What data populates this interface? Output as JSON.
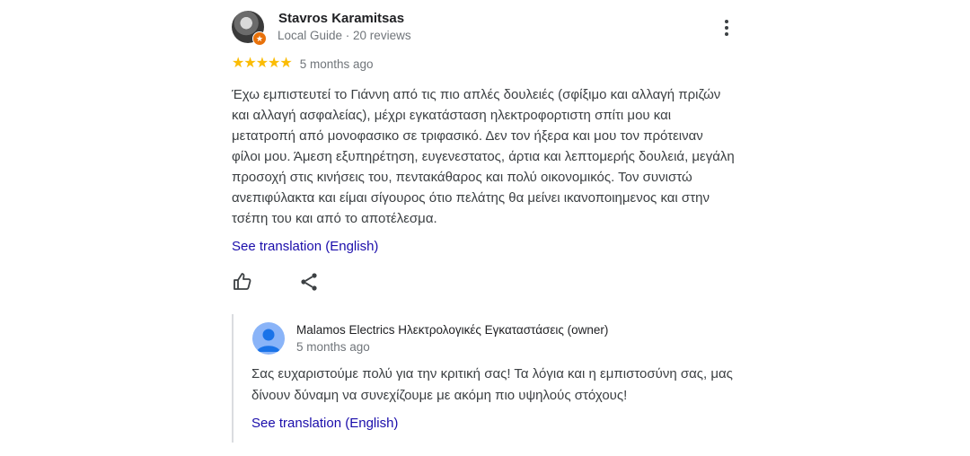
{
  "review": {
    "reviewer_name": "Stavros Karamitsas",
    "reviewer_meta": "Local Guide · 20 reviews",
    "rating": 5,
    "stars": "★★★★★",
    "time": "5 months ago",
    "text": "Έχω εμπιστευτεί το Γιάννη από τις πιο απλές δουλειές (σφίξιμο και αλλαγή πριζών και αλλαγή ασφαλείας), μέχρι εγκατάσταση ηλεκτροφορτιστη σπίτι μου και μετατροπή από μονοφασικο σε τριφασικό. Δεν τον ήξερα και μου τον πρότειναν φίλοι μου. Άμεση εξυπηρέτηση, ευγενεστατος, άρτια και λεπτομερής δουλειά, μεγάλη προσοχή στις κινήσεις του, πεντακάθαρος και πολύ οικονομικός. Τον συνιστώ ανεπιφύλακτα και είμαι σίγουρος ότιο πελάτης θα μείνει ικανοποιημενος και στην τσέπη του και από το αποτέλεσμα.",
    "see_translation": "See translation (English)"
  },
  "owner_reply": {
    "owner_name": "Malamos Electrics Ηλεκτρολογικές Εγκαταστάσεις (owner)",
    "time": "5 months ago",
    "text": "Σας ευχαριστούμε πολύ για την κριτική σας! Τα λόγια και η εμπιστοσύνη σας, μας δίνουν δύναμη να συνεχίζουμε με ακόμη πιο υψηλούς στόχους!",
    "see_translation": "See translation (English)"
  },
  "icons": {
    "more": "more-vertical-icon",
    "like": "thumbs-up-icon",
    "share": "share-icon",
    "badge": "local-guide-badge-icon"
  },
  "colors": {
    "star": "#fbbc04",
    "link": "#1a0dab",
    "badge": "#e8710a",
    "owner_avatar": "#8ab4f8"
  }
}
